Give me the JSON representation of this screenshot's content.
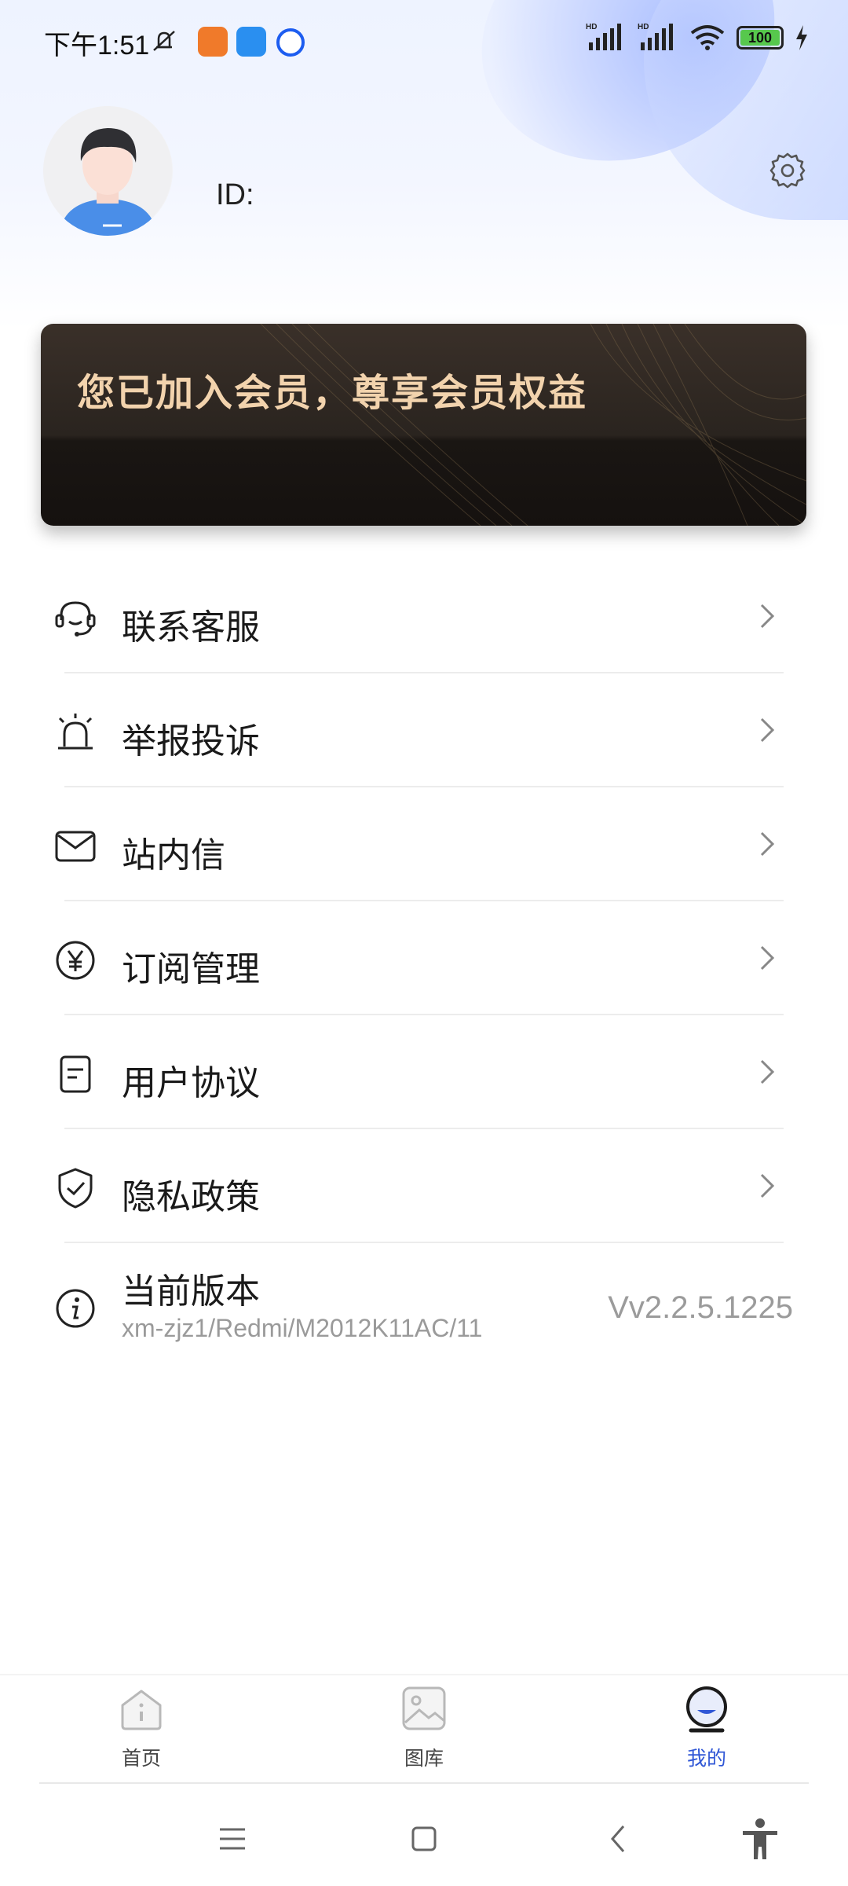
{
  "status_bar": {
    "time": "下午1:51",
    "battery": "100",
    "signal_badge_1": "HD",
    "signal_badge_2": "HD"
  },
  "profile": {
    "id_label": "ID:"
  },
  "member_card": {
    "text": "您已加入会员，尊享会员权益"
  },
  "menu": {
    "items": [
      {
        "label": "联系客服",
        "icon": "headset-icon"
      },
      {
        "label": "举报投诉",
        "icon": "alarm-icon"
      },
      {
        "label": "站内信",
        "icon": "mail-icon"
      },
      {
        "label": "订阅管理",
        "icon": "yen-icon"
      },
      {
        "label": "用户协议",
        "icon": "document-icon"
      },
      {
        "label": "隐私政策",
        "icon": "shield-check-icon"
      }
    ],
    "version": {
      "title": "当前版本",
      "subtitle": "xm-zjz1/Redmi/M2012K11AC/11",
      "value": "Vv2.2.5.1225"
    }
  },
  "bottom_nav": {
    "tabs": [
      {
        "label": "首页",
        "icon": "home-icon"
      },
      {
        "label": "图库",
        "icon": "gallery-icon"
      },
      {
        "label": "我的",
        "icon": "profile-icon",
        "active": true
      }
    ]
  },
  "colors": {
    "accent": "#3057d6",
    "card_text": "#f2d3ad",
    "card_bg": "#2a241f"
  }
}
